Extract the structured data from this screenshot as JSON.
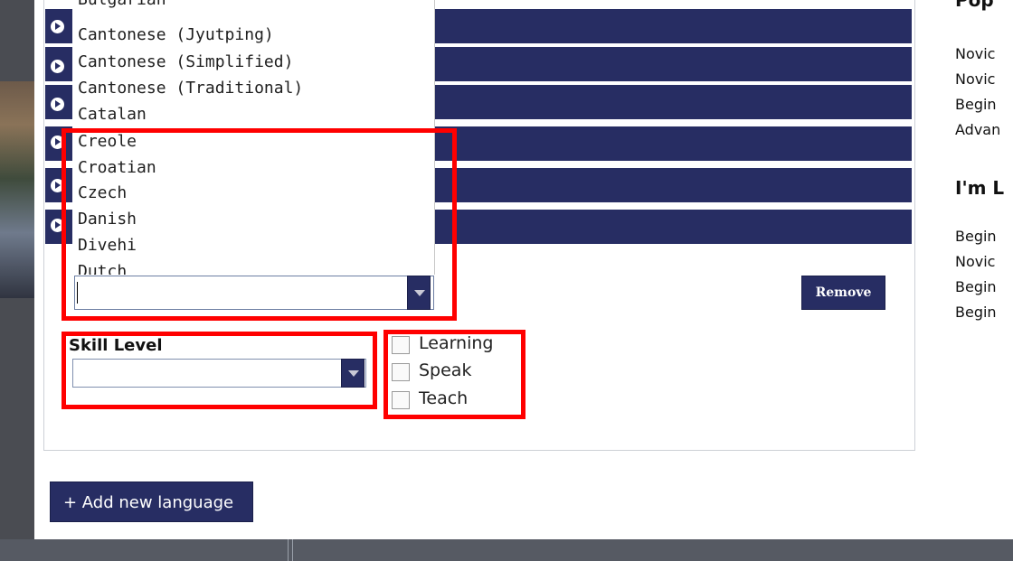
{
  "language_list": {
    "options": [
      "Bulgarian",
      "Cantonese (Jyutping)",
      "Cantonese (Simplified)",
      "Cantonese (Traditional)",
      "Catalan",
      "Creole",
      "Croatian",
      "Czech",
      "Danish",
      "Divehi",
      "Dutch"
    ],
    "selected_value": ""
  },
  "remove_button": {
    "label": "Remove"
  },
  "skill": {
    "label": "Skill Level",
    "selected_value": ""
  },
  "checkboxes": [
    {
      "label": "Learning",
      "checked": false
    },
    {
      "label": "Speak",
      "checked": false
    },
    {
      "label": "Teach",
      "checked": false
    }
  ],
  "add_button": {
    "label": "+ Add new language"
  },
  "right_column": {
    "heading_top": "Pop",
    "items_top": [
      "Novic",
      "Novic",
      "Begin",
      "Advan"
    ],
    "heading_2": "I'm L",
    "items_bottom": [
      "Begin",
      "Novic",
      "Begin",
      "Begin"
    ]
  },
  "colors": {
    "navy": "#272d63",
    "highlight": "#ff0000"
  },
  "icons": [
    "bullet-arrow-icon",
    "chevron-down-icon",
    "scroll-down-arrow-icon"
  ]
}
